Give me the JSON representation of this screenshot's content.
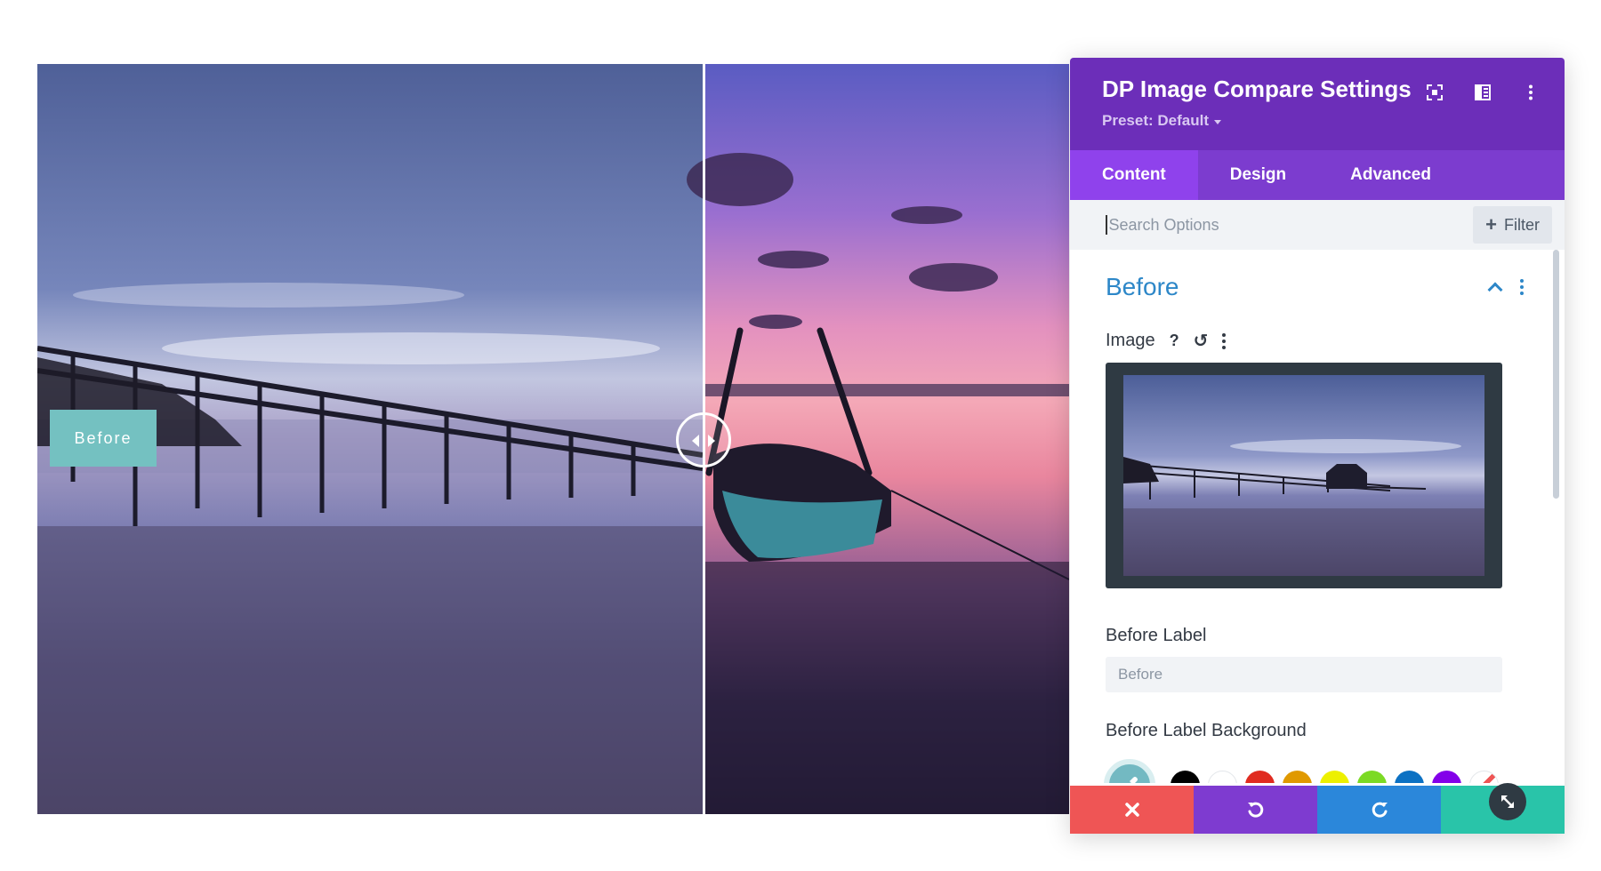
{
  "compare": {
    "before_label": "Before"
  },
  "panel": {
    "title": "DP Image Compare Settings",
    "preset": "Preset: Default",
    "header_icons": [
      "fullscreen-icon",
      "sidebar-layout-icon",
      "more-vertical-icon"
    ],
    "tabs": [
      {
        "label": "Content",
        "active": true
      },
      {
        "label": "Design",
        "active": false
      },
      {
        "label": "Advanced",
        "active": false
      }
    ],
    "search": {
      "placeholder": "Search Options",
      "value": "",
      "filter_label": "Filter"
    },
    "section": {
      "title": "Before",
      "image_label": "Image",
      "help_symbol": "?",
      "before_label_title": "Before Label",
      "before_label_value": "Before",
      "bg_title": "Before Label Background",
      "picker_color": "#73b9c2",
      "swatches": [
        "#000000",
        "#ffffff",
        "#e02b20",
        "#e09900",
        "#edf000",
        "#7cda24",
        "#0c71c3",
        "#8300e9",
        "transparent"
      ]
    },
    "footer": {
      "cancel_color": "#ef5555",
      "undo_color": "#7e3bd0",
      "redo_color": "#2b87da",
      "save_color": "#29c4a9"
    }
  },
  "colors": {
    "header": "#6c2eb9",
    "tabs": "#7c3ccf",
    "active_tab": "#8f42ec",
    "section_title": "#2d87c8",
    "label_bg": "#74c1c1"
  }
}
